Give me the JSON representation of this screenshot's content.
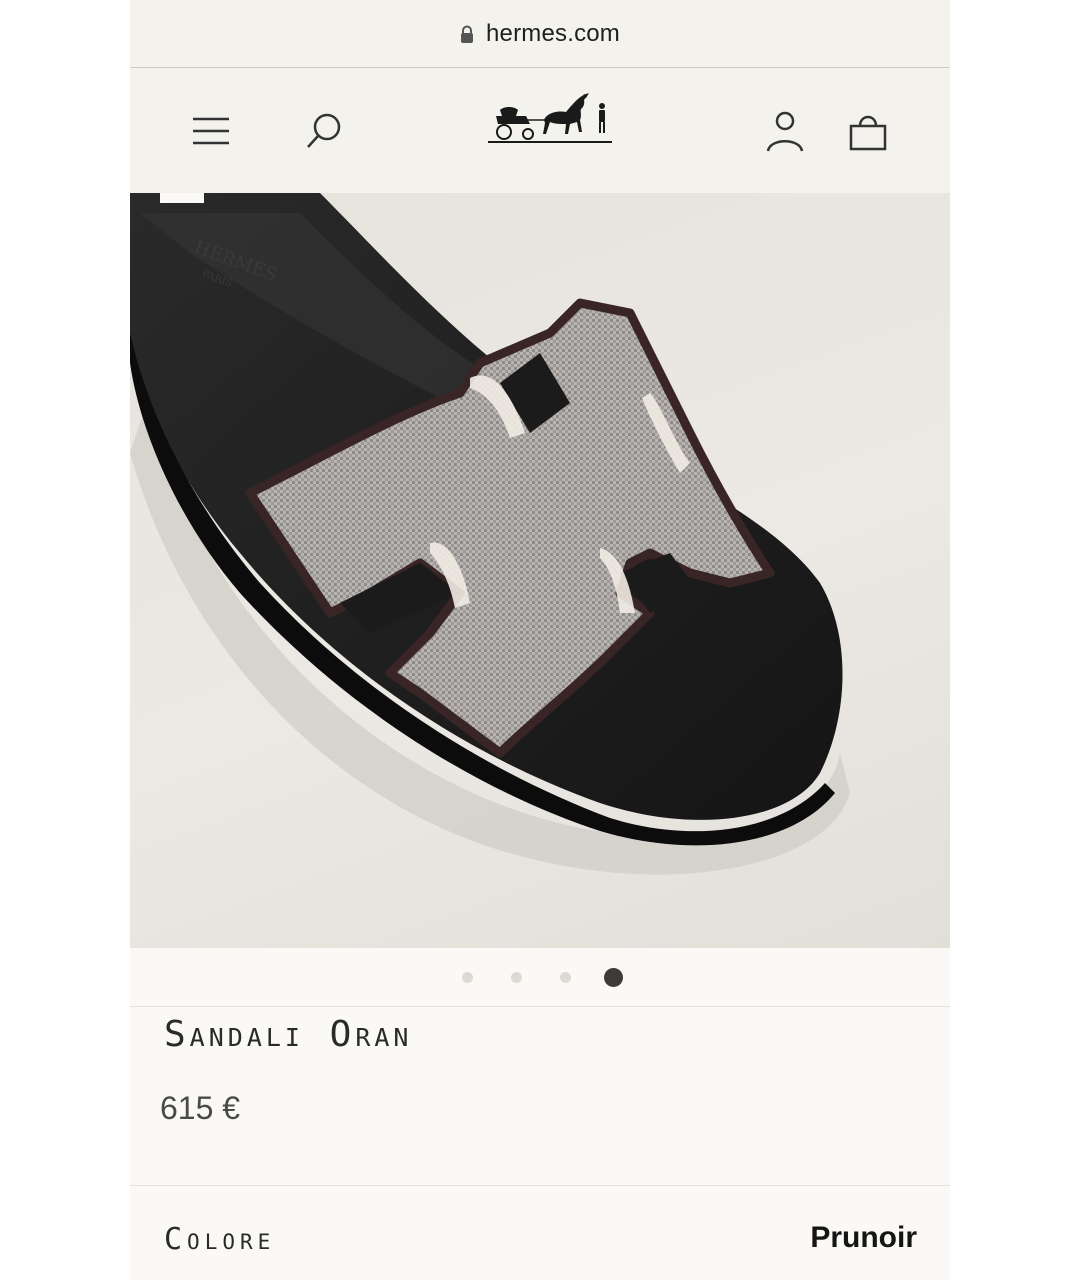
{
  "browser": {
    "host": "hermes.com"
  },
  "header": {
    "menu_icon": "hamburger-menu-icon",
    "search_icon": "search-icon",
    "logo_icon": "carriage-horse-logo",
    "account_icon": "user-icon",
    "bag_icon": "shopping-bag-icon"
  },
  "gallery": {
    "total_images": 4,
    "active_index": 4
  },
  "product": {
    "name": "Sandali Oran",
    "price": "615 €",
    "color_label": "Colore",
    "color_value": "Prunoir"
  },
  "colors": {
    "background": "#f4f2ed",
    "page": "#fbf9f5",
    "text": "#2a2a2a",
    "dot_active": "#3c3b39",
    "dot_inactive": "#dddad4"
  }
}
